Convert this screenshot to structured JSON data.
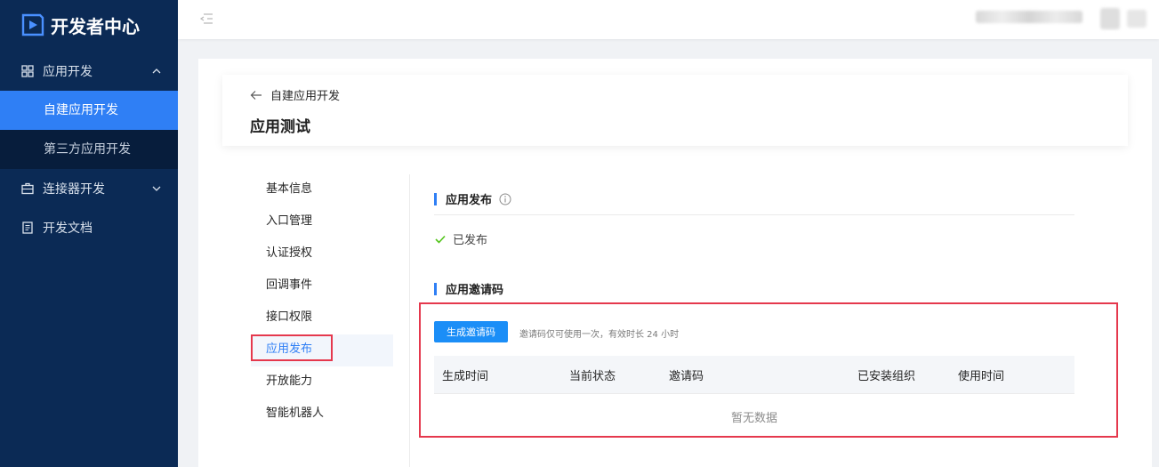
{
  "app": {
    "title": "开发者中心"
  },
  "sidebar": {
    "groups": [
      {
        "label": "应用开发",
        "items": [
          {
            "label": "自建应用开发"
          },
          {
            "label": "第三方应用开发"
          }
        ]
      },
      {
        "label": "连接器开发"
      },
      {
        "label": "开发文档"
      }
    ]
  },
  "page": {
    "back_label": "自建应用开发",
    "title": "应用测试"
  },
  "left_menu": [
    "基本信息",
    "入口管理",
    "认证授权",
    "回调事件",
    "接口权限",
    "应用发布",
    "开放能力",
    "智能机器人"
  ],
  "publish": {
    "title": "应用发布",
    "status": "已发布"
  },
  "invite": {
    "title": "应用邀请码",
    "button": "生成邀请码",
    "hint": "邀请码仅可使用一次，有效时长 24 小时",
    "columns": [
      "生成时间",
      "当前状态",
      "邀请码",
      "已安装组织",
      "使用时间"
    ],
    "empty": "暂无数据"
  },
  "colors": {
    "primary": "#2f7ff5",
    "sidebar": "#0b2a55",
    "highlight": "#e5384d",
    "success": "#52c41a"
  }
}
